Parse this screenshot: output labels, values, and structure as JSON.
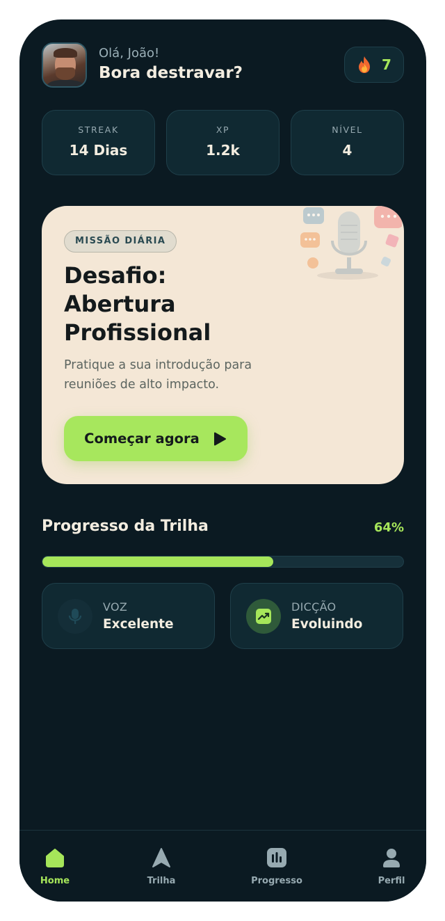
{
  "header": {
    "greeting": "Olá, João!",
    "headline": "Bora destravar?",
    "streak_count": "7"
  },
  "stats": [
    {
      "label": "STREAK",
      "value": "14 Dias"
    },
    {
      "label": "XP",
      "value": "1.2k"
    },
    {
      "label": "NÍVEL",
      "value": "4"
    }
  ],
  "mission": {
    "badge": "MISSÃO DIÁRIA",
    "title_line1": "Desafio:",
    "title_line2": "Abertura",
    "title_line3": "Profissional",
    "description": "Pratique a sua introdução para reuniões de alto impacto.",
    "cta_label": "Começar agora"
  },
  "progress": {
    "title": "Progresso da Trilha",
    "percent_label": "64%",
    "percent_value": 0.64
  },
  "skills": [
    {
      "label": "VOZ",
      "value": "Excelente",
      "icon": "mic-icon"
    },
    {
      "label": "DICÇÃO",
      "value": "Evoluindo",
      "icon": "trend-up-icon"
    }
  ],
  "nav": [
    {
      "label": "Home",
      "icon": "home-icon",
      "active": true
    },
    {
      "label": "Trilha",
      "icon": "navigation-arrow-icon",
      "active": false
    },
    {
      "label": "Progresso",
      "icon": "bar-chart-icon",
      "active": false
    },
    {
      "label": "Perfil",
      "icon": "user-icon",
      "active": false
    }
  ],
  "colors": {
    "background": "#0b1a22",
    "card": "#102932",
    "accent": "#a6e65a",
    "mission_card": "#f4e7d6",
    "text_primary": "#f3ede0",
    "text_muted": "#97aab1"
  }
}
